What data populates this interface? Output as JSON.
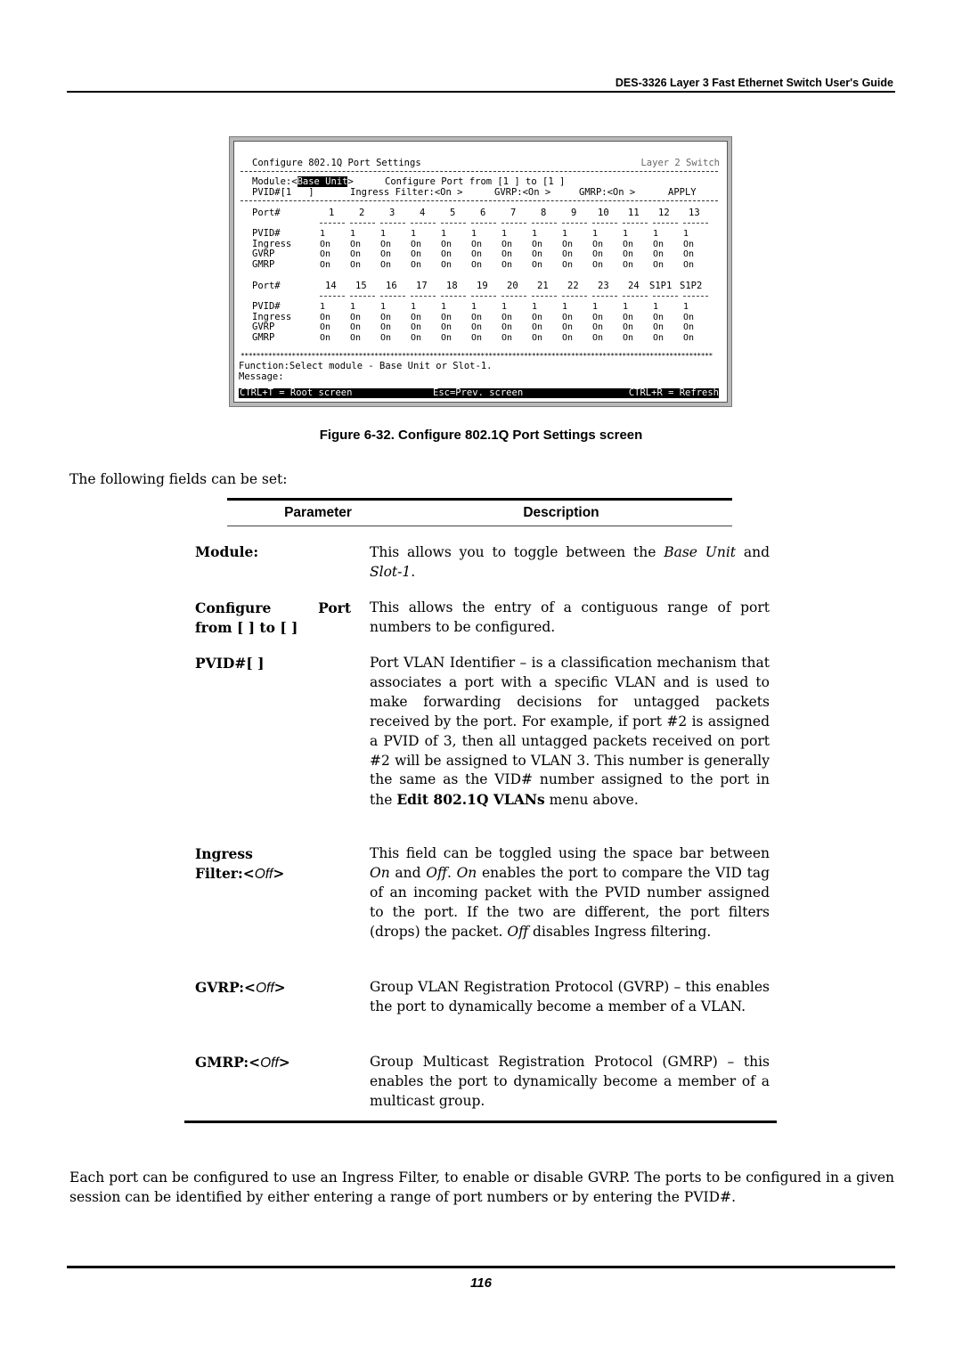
{
  "header": {
    "title": "DES-3326 Layer 3 Fast Ethernet Switch User's Guide"
  },
  "terminal": {
    "title": "Configure 802.1Q Port Settings",
    "product": "Layer 2 Switch",
    "module_label": "Module:<",
    "module_value": "Base Unit",
    "module_close": ">",
    "configure_port": "Configure Port from [1 ] to [1 ]",
    "pvid_field": "PVID#[1   ]",
    "ingress_field": "Ingress Filter:<On >",
    "gvrp_field": "GVRP:<On >",
    "gmrp_field": "GMRP:<On >",
    "apply": "APPLY",
    "port_label": "Port#",
    "row_labels": [
      "PVID#",
      "Ingress",
      "GVRP",
      "GMRP"
    ],
    "group1": {
      "ports": [
        "1",
        "2",
        "3",
        "4",
        "5",
        "6",
        "7",
        "8",
        "9",
        "10",
        "11",
        "12",
        "13"
      ],
      "pvid": [
        "1",
        "1",
        "1",
        "1",
        "1",
        "1",
        "1",
        "1",
        "1",
        "1",
        "1",
        "1",
        "1"
      ],
      "ingress": [
        "On",
        "On",
        "On",
        "On",
        "On",
        "On",
        "On",
        "On",
        "On",
        "On",
        "On",
        "On",
        "On"
      ],
      "gvrp": [
        "On",
        "On",
        "On",
        "On",
        "On",
        "On",
        "On",
        "On",
        "On",
        "On",
        "On",
        "On",
        "On"
      ],
      "gmrp": [
        "On",
        "On",
        "On",
        "On",
        "On",
        "On",
        "On",
        "On",
        "On",
        "On",
        "On",
        "On",
        "On"
      ]
    },
    "group2": {
      "ports": [
        "14",
        "15",
        "16",
        "17",
        "18",
        "19",
        "20",
        "21",
        "22",
        "23",
        "24",
        "S1P1",
        "S1P2"
      ],
      "pvid": [
        "1",
        "1",
        "1",
        "1",
        "1",
        "1",
        "1",
        "1",
        "1",
        "1",
        "1",
        "1",
        "1"
      ],
      "ingress": [
        "On",
        "On",
        "On",
        "On",
        "On",
        "On",
        "On",
        "On",
        "On",
        "On",
        "On",
        "On",
        "On"
      ],
      "gvrp": [
        "On",
        "On",
        "On",
        "On",
        "On",
        "On",
        "On",
        "On",
        "On",
        "On",
        "On",
        "On",
        "On"
      ],
      "gmrp": [
        "On",
        "On",
        "On",
        "On",
        "On",
        "On",
        "On",
        "On",
        "On",
        "On",
        "On",
        "On",
        "On"
      ]
    },
    "stars": "************************************************************************************************************************",
    "function_line": "Function:Select module - Base Unit or Slot-1.",
    "message_line": "Message:",
    "status_left": "CTRL+T = Root screen",
    "status_mid": "Esc=Prev. screen",
    "status_right": "CTRL+R = Refresh"
  },
  "figure_caption": "Figure 6-32. Configure 802.1Q Port Settings screen",
  "intro": "The following fields can be set:",
  "table": {
    "header_param": "Parameter",
    "header_desc": "Description",
    "rows": [
      {
        "name": "Module:",
        "desc_a": "This allows you to toggle between the ",
        "desc_i1": "Base Unit",
        "desc_b": " and ",
        "desc_i2": "Slot-1",
        "desc_c": "."
      },
      {
        "name_a": "Configure",
        "name_b": "Port",
        "name_c": "from [ ] to [  ]",
        "desc": "This allows the entry of a contiguous range of port numbers to be configured."
      },
      {
        "name": "PVID#[  ]",
        "desc_a": "Port VLAN Identifier – is a classification mechanism that associates a port with a specific VLAN and is used to make forwarding decisions for untagged packets received by the port. For example, if port #2 is assigned a PVID of 3, then all untagged packets received on port #2 will be assigned to VLAN 3. This number is generally the same as the VID# number assigned to the port in the ",
        "desc_bold": "Edit 802.1Q VLANs",
        "desc_b": " menu above."
      },
      {
        "name_a": "Ingress",
        "name_b": "Filter:<",
        "name_i": "Off",
        "name_c": ">",
        "desc_a": "This field can be toggled using the space bar between ",
        "desc_i1": "On",
        "desc_b": " and ",
        "desc_i2": "Off",
        "desc_c": ". ",
        "desc_i3": "On",
        "desc_d": " enables the port to compare the VID tag of an incoming packet with the PVID number assigned to the port.  If the two are different, the port filters (drops) the packet. ",
        "desc_i4": "Off",
        "desc_e": " disables Ingress filtering."
      },
      {
        "name_a": "GVRP:<",
        "name_i": "Off",
        "name_c": ">",
        "desc": "Group VLAN Registration Protocol (GVRP) – this enables the port to dynamically become a member of a VLAN."
      },
      {
        "name_a": "GMRP:<",
        "name_i": "Off",
        "name_c": ">",
        "desc": "Group Multicast Registration Protocol (GMRP) – this enables the port to dynamically become a member of a multicast group."
      }
    ]
  },
  "closing": "Each port can be configured to use an Ingress Filter, to enable or disable GVRP. The ports to be configured in a given session can be identified by either entering a range of port numbers or by entering the PVID#.",
  "page_number": "116"
}
